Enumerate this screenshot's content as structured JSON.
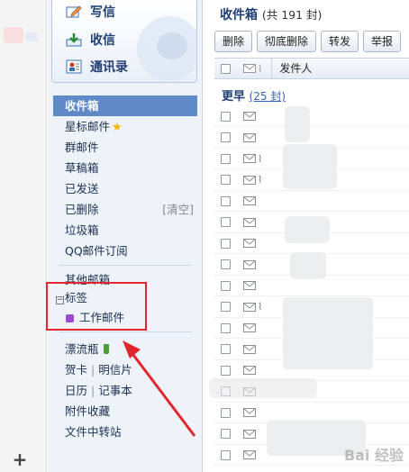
{
  "top_actions": {
    "write": "写信",
    "receive": "收信",
    "contacts": "通讯录"
  },
  "folders": {
    "inbox": "收件箱",
    "starred": "星标邮件",
    "group": "群邮件",
    "drafts": "草稿箱",
    "sent": "已发送",
    "deleted": "已删除",
    "clear": "[清空]",
    "junk": "垃圾箱",
    "subscriptions": "QQ邮件订阅",
    "other": "其他邮箱"
  },
  "tags": {
    "header": "标签",
    "collapse_symbol": "−",
    "work": "工作邮件",
    "work_color": "#9a4bd1"
  },
  "extras": {
    "drift_bottle": "漂流瓶",
    "greeting_card": "贺卡",
    "postcard": "明信片",
    "calendar": "日历",
    "notepad": "记事本",
    "attachments": "附件收藏",
    "file_transfer": "文件中转站"
  },
  "main": {
    "title": "收件箱",
    "count": "(共 191 封)",
    "toolbar": {
      "delete": "删除",
      "delete_permanently": "彻底删除",
      "forward": "转发",
      "more": "举报"
    },
    "header_sender": "发件人",
    "group_title": "更早",
    "group_count": "(25 封)"
  },
  "mail_rows": [
    {
      "attachment": false
    },
    {
      "attachment": false
    },
    {
      "attachment": true
    },
    {
      "attachment": true
    },
    {
      "attachment": false
    },
    {
      "attachment": false
    },
    {
      "attachment": false
    },
    {
      "attachment": false
    },
    {
      "attachment": false
    },
    {
      "attachment": true
    },
    {
      "attachment": false
    },
    {
      "attachment": false
    },
    {
      "attachment": false
    },
    {
      "attachment": false
    },
    {
      "attachment": false
    },
    {
      "attachment": false
    },
    {
      "attachment": false
    }
  ],
  "watermark": "Bai 经验",
  "colors": {
    "accent": "#5f8ac7",
    "highlight_box": "#e3262d"
  }
}
